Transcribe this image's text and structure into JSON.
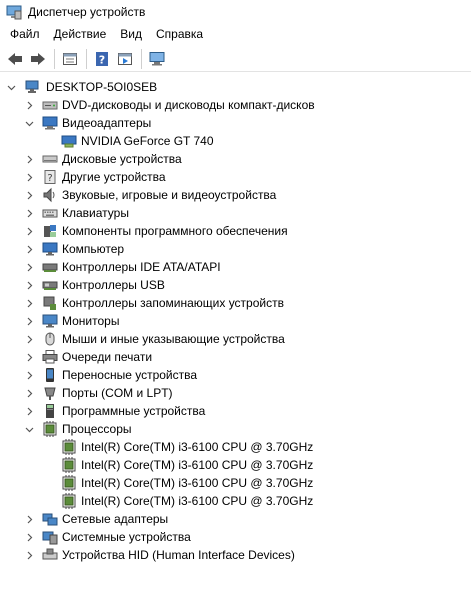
{
  "window": {
    "title": "Диспетчер устройств"
  },
  "menu": [
    "Файл",
    "Действие",
    "Вид",
    "Справка"
  ],
  "toolbar": {
    "buttons": [
      "back-icon",
      "forward-icon",
      "properties-icon",
      "help-icon",
      "update-driver-icon",
      "scan-hardware-icon"
    ]
  },
  "tree": {
    "root": "DESKTOP-5OI0SEB",
    "items": [
      {
        "label": "DVD-дисководы и дисководы компакт-дисков",
        "icon": "dvd-drive-icon",
        "expanded": false
      },
      {
        "label": "Видеоадаптеры",
        "icon": "display-adapter-icon",
        "expanded": true,
        "children": [
          "NVIDIA GeForce GT 740"
        ]
      },
      {
        "label": "Дисковые устройства",
        "icon": "disk-drive-icon",
        "expanded": false
      },
      {
        "label": "Другие устройства",
        "icon": "other-devices-icon",
        "expanded": false
      },
      {
        "label": "Звуковые, игровые и видеоустройства",
        "icon": "sound-icon",
        "expanded": false
      },
      {
        "label": "Клавиатуры",
        "icon": "keyboard-icon",
        "expanded": false
      },
      {
        "label": "Компоненты программного обеспечения",
        "icon": "software-component-icon",
        "expanded": false
      },
      {
        "label": "Компьютер",
        "icon": "computer-icon",
        "expanded": false
      },
      {
        "label": "Контроллеры IDE ATA/ATAPI",
        "icon": "ide-controller-icon",
        "expanded": false
      },
      {
        "label": "Контроллеры USB",
        "icon": "usb-icon",
        "expanded": false
      },
      {
        "label": "Контроллеры запоминающих устройств",
        "icon": "storage-controller-icon",
        "expanded": false
      },
      {
        "label": "Мониторы",
        "icon": "monitor-icon",
        "expanded": false
      },
      {
        "label": "Мыши и иные указывающие устройства",
        "icon": "mouse-icon",
        "expanded": false
      },
      {
        "label": "Очереди печати",
        "icon": "printer-icon",
        "expanded": false
      },
      {
        "label": "Переносные устройства",
        "icon": "portable-device-icon",
        "expanded": false
      },
      {
        "label": "Порты (COM и LPT)",
        "icon": "port-icon",
        "expanded": false
      },
      {
        "label": "Программные устройства",
        "icon": "software-device-icon",
        "expanded": false
      },
      {
        "label": "Процессоры",
        "icon": "processor-icon",
        "expanded": true,
        "children": [
          "Intel(R) Core(TM) i3-6100 CPU @ 3.70GHz",
          "Intel(R) Core(TM) i3-6100 CPU @ 3.70GHz",
          "Intel(R) Core(TM) i3-6100 CPU @ 3.70GHz",
          "Intel(R) Core(TM) i3-6100 CPU @ 3.70GHz"
        ]
      },
      {
        "label": "Сетевые адаптеры",
        "icon": "network-adapter-icon",
        "expanded": false
      },
      {
        "label": "Системные устройства",
        "icon": "system-devices-icon",
        "expanded": false
      },
      {
        "label": "Устройства HID (Human Interface Devices)",
        "icon": "hid-icon",
        "expanded": false
      }
    ]
  },
  "colors": {
    "accent": "#2a7ad5",
    "chevron": "#555555",
    "cpu": "#5b8c3a"
  }
}
